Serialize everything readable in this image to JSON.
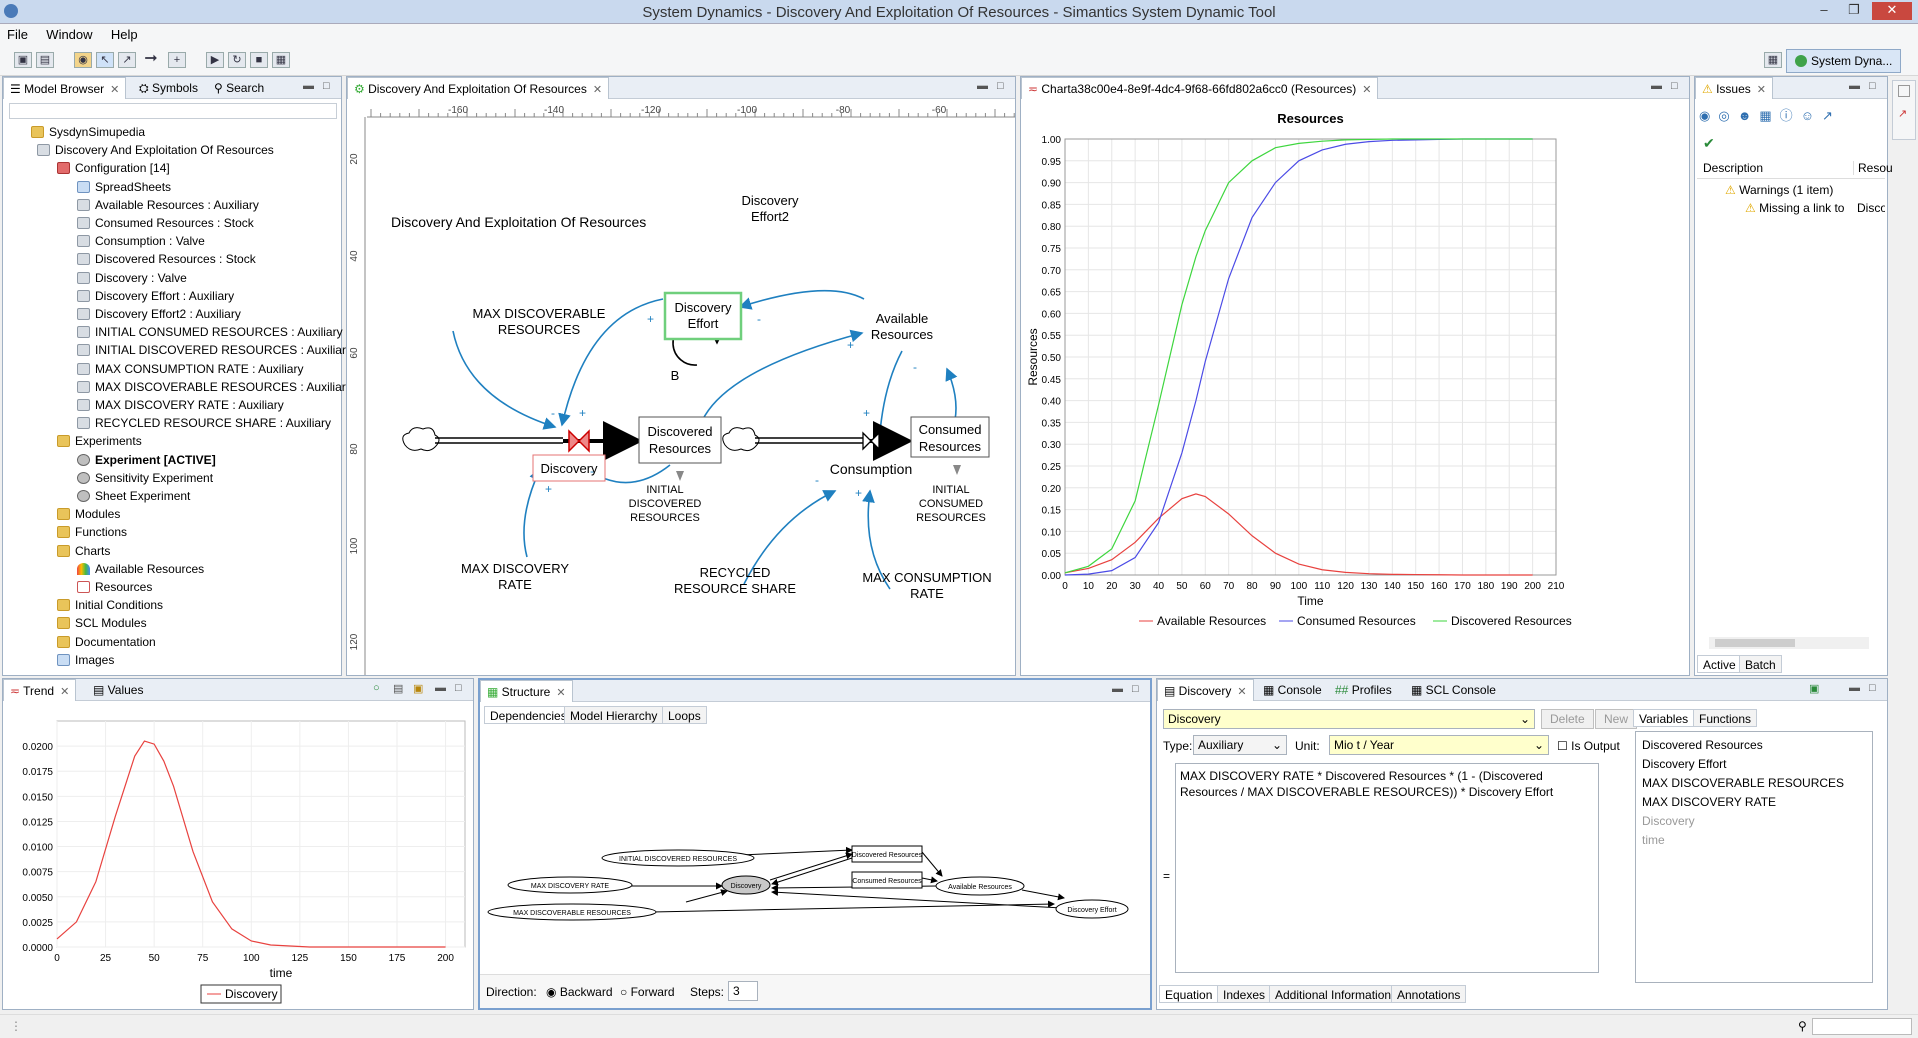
{
  "window": {
    "title": "System Dynamics - Discovery And Exploitation Of Resources - Simantics System Dynamic Tool"
  },
  "menu": [
    "File",
    "Window",
    "Help"
  ],
  "perspective": {
    "label": "System Dyna..."
  },
  "model_browser": {
    "tabs": [
      "Model Browser",
      "Symbols",
      "Search"
    ],
    "items": [
      {
        "label": "SysdynSimupedia",
        "indent": 0,
        "icon": "folder"
      },
      {
        "label": "Discovery And Exploitation Of Resources",
        "indent": 1,
        "icon": "model"
      },
      {
        "label": "Configuration [14]",
        "indent": 2,
        "icon": "configuration"
      },
      {
        "label": "SpreadSheets",
        "indent": 3,
        "icon": "sheet"
      },
      {
        "label": "Available Resources : Auxiliary",
        "indent": 3,
        "icon": "cube"
      },
      {
        "label": "Consumed Resources : Stock",
        "indent": 3,
        "icon": "cube"
      },
      {
        "label": "Consumption : Valve",
        "indent": 3,
        "icon": "cube"
      },
      {
        "label": "Discovered Resources : Stock",
        "indent": 3,
        "icon": "cube"
      },
      {
        "label": "Discovery : Valve",
        "indent": 3,
        "icon": "cube"
      },
      {
        "label": "Discovery Effort : Auxiliary",
        "indent": 3,
        "icon": "cube"
      },
      {
        "label": "Discovery Effort2 : Auxiliary",
        "indent": 3,
        "icon": "cube"
      },
      {
        "label": "INITIAL CONSUMED RESOURCES : Auxiliary",
        "indent": 3,
        "icon": "cube"
      },
      {
        "label": "INITIAL DISCOVERED RESOURCES : Auxiliary",
        "indent": 3,
        "icon": "cube"
      },
      {
        "label": "MAX CONSUMPTION RATE : Auxiliary",
        "indent": 3,
        "icon": "cube"
      },
      {
        "label": "MAX DISCOVERABLE RESOURCES : Auxiliary",
        "indent": 3,
        "icon": "cube"
      },
      {
        "label": "MAX DISCOVERY RATE : Auxiliary",
        "indent": 3,
        "icon": "cube"
      },
      {
        "label": "RECYCLED RESOURCE SHARE : Auxiliary",
        "indent": 3,
        "icon": "cube"
      },
      {
        "label": "Experiments",
        "indent": 2,
        "icon": "folder"
      },
      {
        "label": "Experiment [ACTIVE]",
        "indent": 3,
        "icon": "experiment",
        "bold": true
      },
      {
        "label": "Sensitivity Experiment",
        "indent": 3,
        "icon": "experiment"
      },
      {
        "label": "Sheet Experiment",
        "indent": 3,
        "icon": "experiment"
      },
      {
        "label": "Modules",
        "indent": 2,
        "icon": "folder"
      },
      {
        "label": "Functions",
        "indent": 2,
        "icon": "folder"
      },
      {
        "label": "Charts",
        "indent": 2,
        "icon": "folder"
      },
      {
        "label": "Available Resources",
        "indent": 3,
        "icon": "chart"
      },
      {
        "label": "Resources",
        "indent": 3,
        "icon": "line-chart"
      },
      {
        "label": "Initial Conditions",
        "indent": 2,
        "icon": "folder"
      },
      {
        "label": "SCL Modules",
        "indent": 2,
        "icon": "folder"
      },
      {
        "label": "Documentation",
        "indent": 2,
        "icon": "folder"
      },
      {
        "label": "Images",
        "indent": 2,
        "icon": "image"
      }
    ]
  },
  "diagram": {
    "tab": "Discovery And Exploitation Of Resources",
    "ruler_top": [
      "-160",
      "-140",
      "-120",
      "-100",
      "-80",
      "-60"
    ],
    "ruler_left": [
      "20",
      "40",
      "60",
      "80",
      "100",
      "120"
    ],
    "title": "Discovery And Exploitation Of Resources",
    "labels": {
      "effort2": [
        "Discovery",
        "Effort2"
      ],
      "max_disc_res": [
        "MAX DISCOVERABLE",
        "RESOURCES"
      ],
      "effort": [
        "Discovery",
        "Effort"
      ],
      "available": [
        "Available",
        "Resources"
      ],
      "loop": "B",
      "discovered": [
        "Discovered",
        "Resources"
      ],
      "discovery": "Discovery",
      "consumed": [
        "Consumed",
        "Resources"
      ],
      "consumption": "Consumption",
      "init_disc": [
        "INITIAL",
        "DISCOVERED",
        "RESOURCES"
      ],
      "init_cons": [
        "INITIAL",
        "CONSUMED",
        "RESOURCES"
      ],
      "max_disc_rate": [
        "MAX DISCOVERY",
        "RATE"
      ],
      "recycled": [
        "RECYCLED",
        "RESOURCE SHARE"
      ],
      "max_cons_rate": [
        "MAX CONSUMPTION",
        "RATE"
      ]
    },
    "signs": [
      "+",
      "-",
      "+",
      "-",
      "+",
      "-",
      "+",
      "-",
      "+",
      "-",
      "+"
    ]
  },
  "resources_chart": {
    "tab": "Charta38c00e4-8e9f-4dc4-9f68-66fd802a6cc0 (Resources)",
    "colors": {
      "available": "#e8423f",
      "consumed": "#4b4be6",
      "discovered": "#3ed63e"
    }
  },
  "issues": {
    "tabs": [
      "Issues"
    ],
    "col_description": "Description",
    "col_resource": "Resou",
    "warnings": "Warnings (1 item)",
    "item": "Missing a link to",
    "item_res": "Disco",
    "bottom_tabs": [
      "Active",
      "Batch"
    ]
  },
  "trend": {
    "tabs": [
      "Trend",
      "Values"
    ]
  },
  "structure": {
    "tab": "Structure",
    "subtabs": [
      "Dependencies",
      "Model Hierarchy",
      "Loops"
    ],
    "graph": {
      "init_disc": "INITIAL DISCOVERED RESOURCES",
      "max_rate": "MAX DISCOVERY RATE",
      "max_res": "MAX DISCOVERABLE RESOURCES",
      "discovery": "Discovery",
      "discovered": "Discovered Resources",
      "consumed": "Consumed Resources",
      "available": "Available Resources",
      "effort": "Discovery Effort"
    },
    "direction_label": "Direction:",
    "backward": "Backward",
    "forward": "Forward",
    "steps_label": "Steps:",
    "steps": "3"
  },
  "properties": {
    "tabs": [
      "Discovery",
      "Console",
      "Profiles",
      "SCL Console"
    ],
    "variable": "Discovery",
    "delete": "Delete",
    "new": "New",
    "type_label": "Type:",
    "type": "Auxiliary",
    "unit_label": "Unit:",
    "unit": "Mio t / Year",
    "is_output": "Is Output",
    "equation": "MAX DISCOVERY RATE * Discovered Resources * (1 - (Discovered Resources / MAX DISCOVERABLE RESOURCES)) * Discovery Effort",
    "eq_sign": "=",
    "var_tabs": [
      "Variables",
      "Functions"
    ],
    "variables": [
      "Discovered Resources",
      "Discovery Effort",
      "MAX DISCOVERABLE RESOURCES",
      "MAX DISCOVERY RATE",
      "Discovery",
      "time"
    ],
    "bottom_tabs": [
      "Equation",
      "Indexes",
      "Additional Information",
      "Annotations"
    ]
  },
  "chart_data": [
    {
      "type": "line",
      "title": "Resources",
      "xlabel": "Time",
      "ylabel": "Resources",
      "xlim": [
        0,
        210
      ],
      "ylim": [
        0,
        1.0
      ],
      "x_ticks": [
        0,
        10,
        20,
        30,
        40,
        50,
        60,
        70,
        80,
        90,
        100,
        110,
        120,
        130,
        140,
        150,
        160,
        170,
        180,
        190,
        200,
        210
      ],
      "y_ticks": [
        "0.00",
        "0.05",
        "0.10",
        "0.15",
        "0.20",
        "0.25",
        "0.30",
        "0.35",
        "0.40",
        "0.45",
        "0.50",
        "0.55",
        "0.60",
        "0.65",
        "0.70",
        "0.75",
        "0.80",
        "0.85",
        "0.90",
        "0.95",
        "1.00"
      ],
      "x": [
        0,
        10,
        20,
        30,
        40,
        50,
        56,
        60,
        70,
        80,
        90,
        100,
        110,
        120,
        130,
        140,
        150,
        160,
        170,
        180,
        190,
        200
      ],
      "series": [
        {
          "name": "Available Resources",
          "values": [
            0.005,
            0.015,
            0.035,
            0.075,
            0.13,
            0.175,
            0.186,
            0.18,
            0.14,
            0.09,
            0.05,
            0.025,
            0.012,
            0.006,
            0.003,
            0.0015,
            0.001,
            0.0005,
            0,
            0,
            0,
            0
          ]
        },
        {
          "name": "Consumed Resources",
          "values": [
            0,
            0.002,
            0.01,
            0.04,
            0.12,
            0.28,
            0.4,
            0.49,
            0.68,
            0.82,
            0.9,
            0.95,
            0.975,
            0.988,
            0.994,
            0.997,
            0.998,
            0.999,
            1.0,
            1.0,
            1.0,
            1.0
          ]
        },
        {
          "name": "Discovered Resources",
          "values": [
            0.005,
            0.02,
            0.06,
            0.17,
            0.39,
            0.62,
            0.73,
            0.79,
            0.9,
            0.95,
            0.98,
            0.99,
            0.995,
            0.998,
            0.999,
            1.0,
            1.0,
            1.0,
            1.0,
            1.0,
            1.0,
            1.0
          ]
        }
      ]
    },
    {
      "type": "line",
      "xlabel": "time",
      "xlim": [
        0,
        210
      ],
      "ylim": [
        0,
        0.0225
      ],
      "x_ticks": [
        0,
        25,
        50,
        75,
        100,
        125,
        150,
        175,
        200
      ],
      "y_ticks": [
        "0.0000",
        "0.0025",
        "0.0050",
        "0.0075",
        "0.0100",
        "0.0125",
        "0.0150",
        "0.0175",
        "0.0200"
      ],
      "x": [
        0,
        10,
        20,
        30,
        40,
        45,
        50,
        55,
        60,
        70,
        80,
        90,
        100,
        110,
        120,
        130,
        140,
        160,
        200
      ],
      "series": [
        {
          "name": "Discovery",
          "values": [
            0.0008,
            0.0025,
            0.0065,
            0.013,
            0.019,
            0.0205,
            0.0202,
            0.0185,
            0.016,
            0.0095,
            0.0045,
            0.0018,
            0.0006,
            0.0002,
            0.0001,
            0,
            0,
            0,
            0
          ]
        }
      ]
    }
  ]
}
